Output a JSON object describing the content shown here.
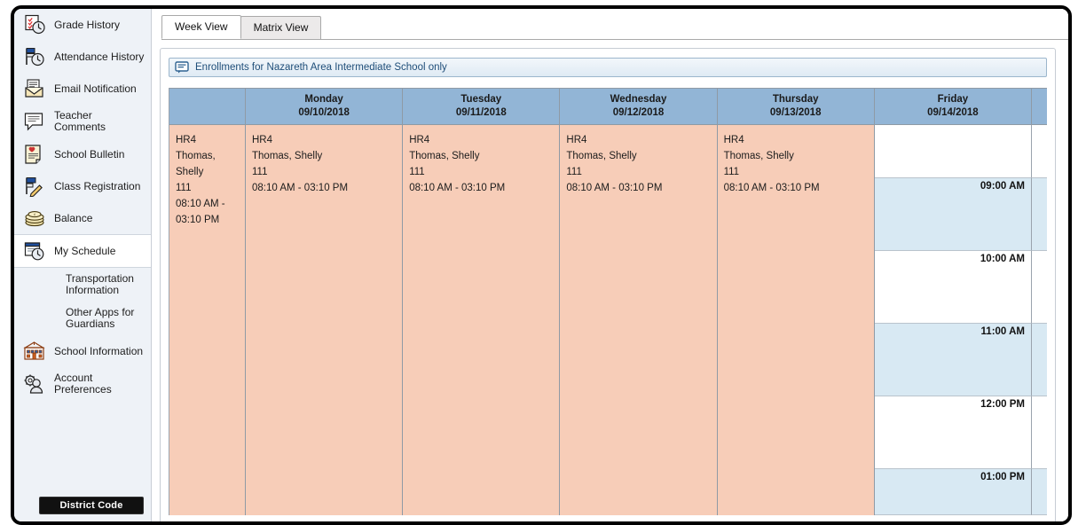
{
  "sidebar": {
    "items": [
      {
        "label": "Grade History",
        "icon": "grade-history-icon",
        "selected": false,
        "sub": false
      },
      {
        "label": "Attendance History",
        "icon": "attendance-history-icon",
        "selected": false,
        "sub": false
      },
      {
        "label": "Email Notification",
        "icon": "email-notification-icon",
        "selected": false,
        "sub": false
      },
      {
        "label": "Teacher Comments",
        "icon": "teacher-comments-icon",
        "selected": false,
        "sub": false
      },
      {
        "label": "School Bulletin",
        "icon": "school-bulletin-icon",
        "selected": false,
        "sub": false
      },
      {
        "label": "Class Registration",
        "icon": "class-registration-icon",
        "selected": false,
        "sub": false
      },
      {
        "label": "Balance",
        "icon": "balance-icon",
        "selected": false,
        "sub": false
      },
      {
        "label": "My Schedule",
        "icon": "my-schedule-icon",
        "selected": true,
        "sub": false
      },
      {
        "label": "Transportation Information",
        "icon": "none",
        "selected": false,
        "sub": true
      },
      {
        "label": "Other Apps for Guardians",
        "icon": "none",
        "selected": false,
        "sub": true
      },
      {
        "label": "School Information",
        "icon": "school-information-icon",
        "selected": false,
        "sub": false
      },
      {
        "label": "Account Preferences",
        "icon": "account-preferences-icon",
        "selected": false,
        "sub": false
      }
    ],
    "district_button": "District Code"
  },
  "tabs": [
    {
      "label": "Week View",
      "active": true
    },
    {
      "label": "Matrix View",
      "active": false
    }
  ],
  "infobar": {
    "icon": "message-monitor-icon",
    "text": "Enrollments for Nazareth Area Intermediate School only"
  },
  "calendar": {
    "days": [
      {
        "name": "Monday",
        "date": "09/10/2018"
      },
      {
        "name": "Tuesday",
        "date": "09/11/2018"
      },
      {
        "name": "Wednesday",
        "date": "09/12/2018"
      },
      {
        "name": "Thursday",
        "date": "09/13/2018"
      },
      {
        "name": "Friday",
        "date": "09/14/2018"
      }
    ],
    "time_rows": [
      {
        "label": "",
        "shaded": false
      },
      {
        "label": "09:00 AM",
        "shaded": true
      },
      {
        "label": "10:00 AM",
        "shaded": false
      },
      {
        "label": "11:00 AM",
        "shaded": true
      },
      {
        "label": "12:00 PM",
        "shaded": false
      },
      {
        "label": "01:00 PM",
        "shaded": true
      }
    ],
    "events": [
      {
        "course": "HR4",
        "teacher": "Thomas, Shelly",
        "room": "111",
        "time": "08:10 AM - 03:10 PM"
      },
      {
        "course": "HR4",
        "teacher": "Thomas, Shelly",
        "room": "111",
        "time": "08:10 AM - 03:10 PM"
      },
      {
        "course": "HR4",
        "teacher": "Thomas, Shelly",
        "room": "111",
        "time": "08:10 AM - 03:10 PM"
      },
      {
        "course": "HR4",
        "teacher": "Thomas, Shelly",
        "room": "111",
        "time": "08:10 AM - 03:10 PM"
      },
      {
        "course": "HR4",
        "teacher": "Thomas, Shelly",
        "room": "111",
        "time": "08:10 AM - 03:10 PM"
      }
    ]
  },
  "colors": {
    "header_blue": "#92b5d6",
    "event_peach": "#f7cdb8",
    "row_shade": "#d8e9f3",
    "sidebar_bg": "#eef2f7",
    "infobar_text": "#1f4e79"
  }
}
